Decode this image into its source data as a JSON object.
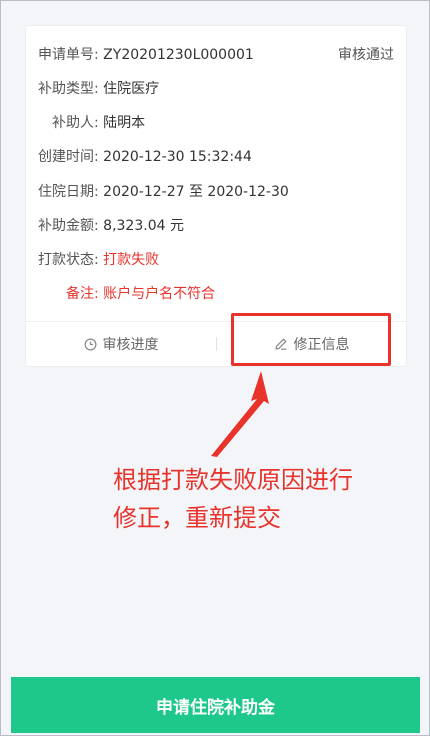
{
  "card": {
    "application_no_label": "申请单号:",
    "application_no": "ZY20201230L000001",
    "review_status": "审核通过",
    "subsidy_type_label": "补助类型:",
    "subsidy_type": "住院医疗",
    "recipient_label": "补助人:",
    "recipient": "陆明本",
    "created_label": "创建时间:",
    "created": "2020-12-30 15:32:44",
    "hospital_date_label": "住院日期:",
    "hospital_date": "2020-12-27 至 2020-12-30",
    "amount_label": "补助金额:",
    "amount": "8,323.04 元",
    "payment_status_label": "打款状态:",
    "payment_status": "打款失败",
    "remark_label": "备注:",
    "remark": "账户与户名不符合"
  },
  "actions": {
    "progress_label": "审核进度",
    "correct_label": "修正信息"
  },
  "annotation": {
    "text": "根据打款失败原因进行修正，重新提交"
  },
  "submit": {
    "label": "申请住院补助金"
  },
  "colors": {
    "accent_green": "#1ec78a",
    "error_red": "#e8332b"
  },
  "icons": [
    "clock-icon",
    "edit-pen-icon"
  ]
}
